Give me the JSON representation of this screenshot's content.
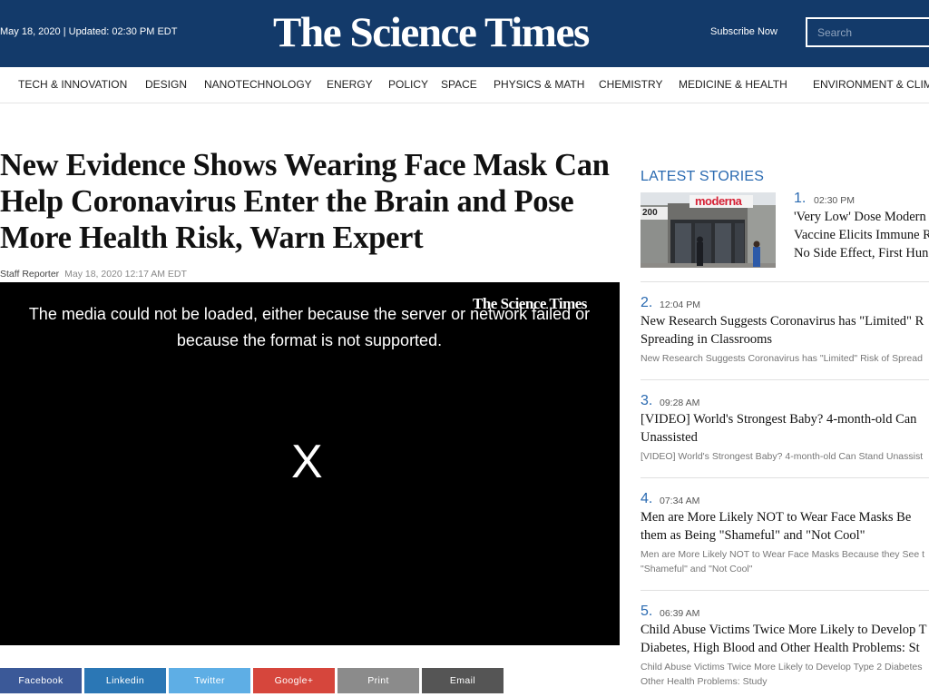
{
  "header": {
    "date": "May 18, 2020 | Updated: 02:30 PM EDT",
    "logo": "The Science Times",
    "subscribe": "Subscribe Now",
    "search_placeholder": "Search",
    "bg_color": "#133a6a"
  },
  "nav": {
    "items": [
      "TECH & INNOVATION",
      "DESIGN",
      "NANOTECHNOLOGY",
      "ENERGY",
      "POLICY",
      "SPACE",
      "PHYSICS & MATH",
      "CHEMISTRY",
      "MEDICINE & HEALTH",
      "ENVIRONMENT & CLIMA"
    ]
  },
  "article": {
    "headline": "New Evidence Shows Wearing Face Mask Can Help Coronavirus Enter the Brain and Pose More Health Risk, Warn Expert",
    "author": "Staff Reporter",
    "timestamp": "May 18, 2020 12:17 AM EDT",
    "media": {
      "watermark": "The Science Times",
      "error_message": "The media could not be loaded, either because the server or network failed or because the format is not supported.",
      "close_glyph": "X"
    }
  },
  "share": [
    {
      "label": "Facebook",
      "color": "#3b5998"
    },
    {
      "label": "Linkedin",
      "color": "#2b77b5"
    },
    {
      "label": "Twitter",
      "color": "#5eaee5"
    },
    {
      "label": "Google+",
      "color": "#d6463c"
    },
    {
      "label": "Print",
      "color": "#8b8b8b"
    },
    {
      "label": "Email",
      "color": "#555555"
    }
  ],
  "sidebar": {
    "title": "LATEST STORIES",
    "stories": [
      {
        "num": "1.",
        "time": "02:30 PM",
        "title_lines": [
          "'Very Low' Dose Modern",
          "Vaccine Elicits Immune R",
          "No Side Effect, First Hun"
        ],
        "thumb_sign": "moderna",
        "thumb_number": "200"
      },
      {
        "num": "2.",
        "time": "12:04 PM",
        "title_lines": [
          "New Research Suggests Coronavirus has \"Limited\" R",
          "Spreading in Classrooms"
        ],
        "summary_lines": [
          "New Research Suggests Coronavirus has \"Limited\" Risk of Spread"
        ]
      },
      {
        "num": "3.",
        "time": "09:28 AM",
        "title_lines": [
          "[VIDEO] World's Strongest Baby? 4-month-old Can",
          "Unassisted"
        ],
        "summary_lines": [
          "[VIDEO] World's Strongest Baby? 4-month-old Can Stand Unassist"
        ]
      },
      {
        "num": "4.",
        "time": "07:34 AM",
        "title_lines": [
          "Men are More Likely NOT to Wear Face Masks Be",
          "them as Being \"Shameful\" and \"Not Cool\""
        ],
        "summary_lines": [
          "Men are More Likely NOT to Wear Face Masks Because they See t",
          "\"Shameful\" and \"Not Cool\""
        ]
      },
      {
        "num": "5.",
        "time": "06:39 AM",
        "title_lines": [
          "Child Abuse Victims Twice More Likely to Develop T",
          "Diabetes, High Blood and Other Health Problems: St"
        ],
        "summary_lines": [
          "Child Abuse Victims Twice More Likely to Develop Type 2 Diabetes",
          "Other Health Problems: Study"
        ]
      }
    ]
  }
}
